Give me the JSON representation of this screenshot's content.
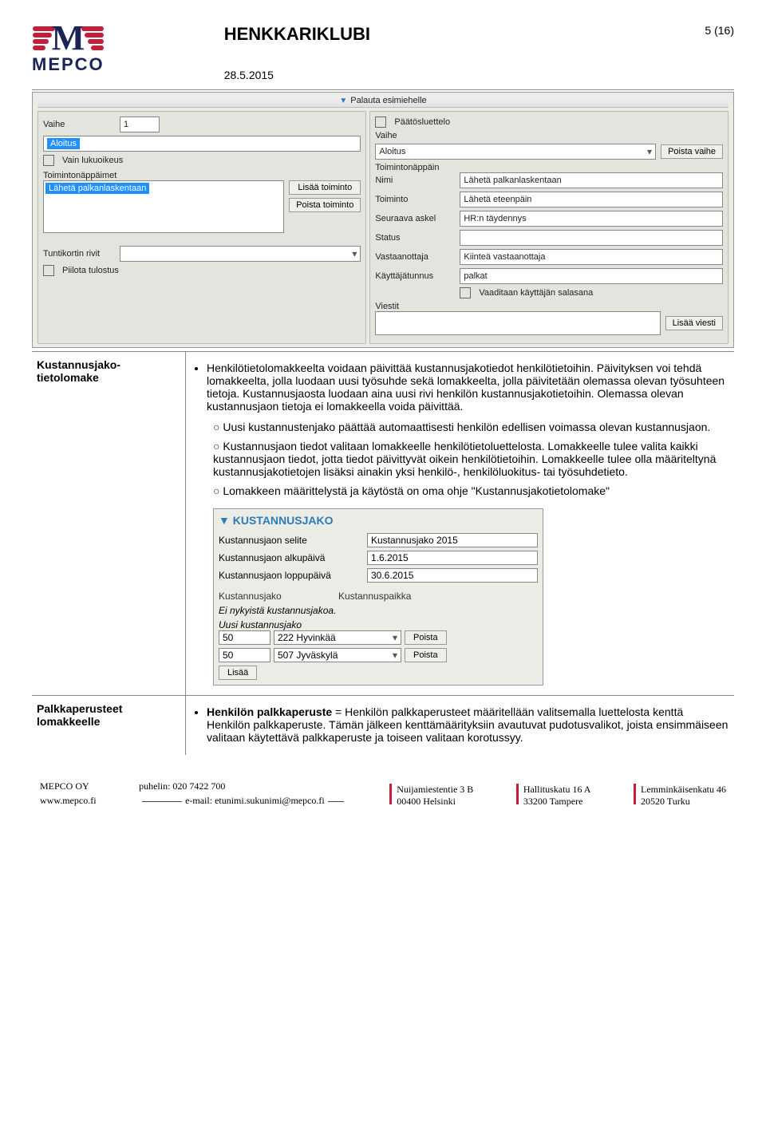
{
  "header": {
    "doc_title": "HENKKARIKLUBI",
    "page_num": "5 (16)",
    "date": "28.5.2015",
    "logo_text": "MEPCO"
  },
  "ss1": {
    "top_link": "Palauta esimiehelle",
    "vaihe": "Vaihe",
    "vaihe_val": "1",
    "aloitus": "Aloitus",
    "vain_luku": "Vain lukuoikeus",
    "toimintonappaimet": "Toimintonäppäimet",
    "laheta_palk": "Lähetä palkanlaskentaan",
    "lisaa_toiminto": "Lisää toiminto",
    "poista_toiminto": "Poista toiminto",
    "tuntikortin": "Tuntikortin rivit",
    "piilota": "Piilota tulostus",
    "paatosluettelo": "Päätösluettelo",
    "vaihe_r": "Vaihe",
    "aloitus_r": "Aloitus",
    "poista_vaihe": "Poista vaihe",
    "toimintonappain_r": "Toimintonäppäin",
    "nimi": "Nimi",
    "nimi_v": "Lähetä palkanlaskentaan",
    "toiminto": "Toiminto",
    "toiminto_v": "Lähetä eteenpäin",
    "seuraava": "Seuraava askel",
    "seuraava_v": "HR:n täydennys",
    "status": "Status",
    "vastaanottaja": "Vastaanottaja",
    "vastaanottaja_v": "Kiinteä vastaanottaja",
    "kayttajatunnus": "Käyttäjätunnus",
    "kayttajatunnus_v": "palkat",
    "vaaditaan": "Vaaditaan käyttäjän salasana",
    "viestit": "Viestit",
    "lisaa_viesti": "Lisää viesti"
  },
  "section1": {
    "title": "Kustannusjako-tietolomake",
    "bullet": "Henkilötietolomakkeelta voidaan päivittää kustannusjakotiedot henkilötietoihin. Päivityksen voi tehdä lomakkeelta, jolla luodaan uusi työsuhde sekä lomakkeelta, jolla päivitetään olemassa olevan työsuhteen tietoja. Kustannusjaosta luodaan aina uusi rivi henkilön kustannusjakotietoihin. Olemassa olevan kustannusjaon tietoja ei lomakkeella voida päivittää.",
    "sub1": "Uusi kustannustenjako päättää automaattisesti henkilön edellisen voimassa olevan kustannusjaon.",
    "sub2": "Kustannusjaon tiedot valitaan lomakkeelle henkilötietoluettelosta. Lomakkeelle tulee valita kaikki kustannusjaon tiedot, jotta tiedot päivittyvät oikein henkilötietoihin. Lomakkeelle tulee olla määriteltynä kustannusjakotietojen lisäksi ainakin yksi henkilö-, henkilöluokitus- tai työsuhdetieto.",
    "sub3": "Lomakkeen määrittelystä ja käytöstä on oma ohje \"Kustannusjakotietolomake\""
  },
  "ss2": {
    "title": "KUSTANNUSJAKO",
    "selite_l": "Kustannusjaon selite",
    "selite_v": "Kustannusjako 2015",
    "alku_l": "Kustannusjaon alkupäivä",
    "alku_v": "1.6.2015",
    "loppu_l": "Kustannusjaon loppupäivä",
    "loppu_v": "30.6.2015",
    "th1": "Kustannusjako",
    "th2": "Kustannuspaikka",
    "no_current": "Ei nykyistä kustannusjakoa.",
    "uusi": "Uusi kustannusjako",
    "r1a": "50",
    "r1b": "222 Hyvinkää",
    "r2a": "50",
    "r2b": "507 Jyväskylä",
    "poista": "Poista",
    "lisaa": "Lisää"
  },
  "section2": {
    "title": "Palkkaperusteet lomakkeelle",
    "bullet_label": "Henkilön palkkaperuste",
    "bullet_text": " = Henkilön palkkaperusteet määritellään valitsemalla luettelosta kenttä Henkilön palkkaperuste. Tämän jälkeen kenttämäärityksiin avautuvat pudotusvalikot, joista ensimmäiseen valitaan käytettävä palkkaperuste ja toiseen valitaan korotussyy."
  },
  "footer": {
    "c1a": "MEPCO OY",
    "c1b": "www.mepco.fi",
    "c2a": "puhelin: 020 7422 700",
    "c2b": "e-mail: etunimi.sukunimi@mepco.fi",
    "c3a": "Nuijamiestentie 3 B",
    "c3b": "00400 Helsinki",
    "c4a": "Hallituskatu 16 A",
    "c4b": "33200 Tampere",
    "c5a": "Lemminkäisenkatu 46",
    "c5b": "20520 Turku"
  }
}
